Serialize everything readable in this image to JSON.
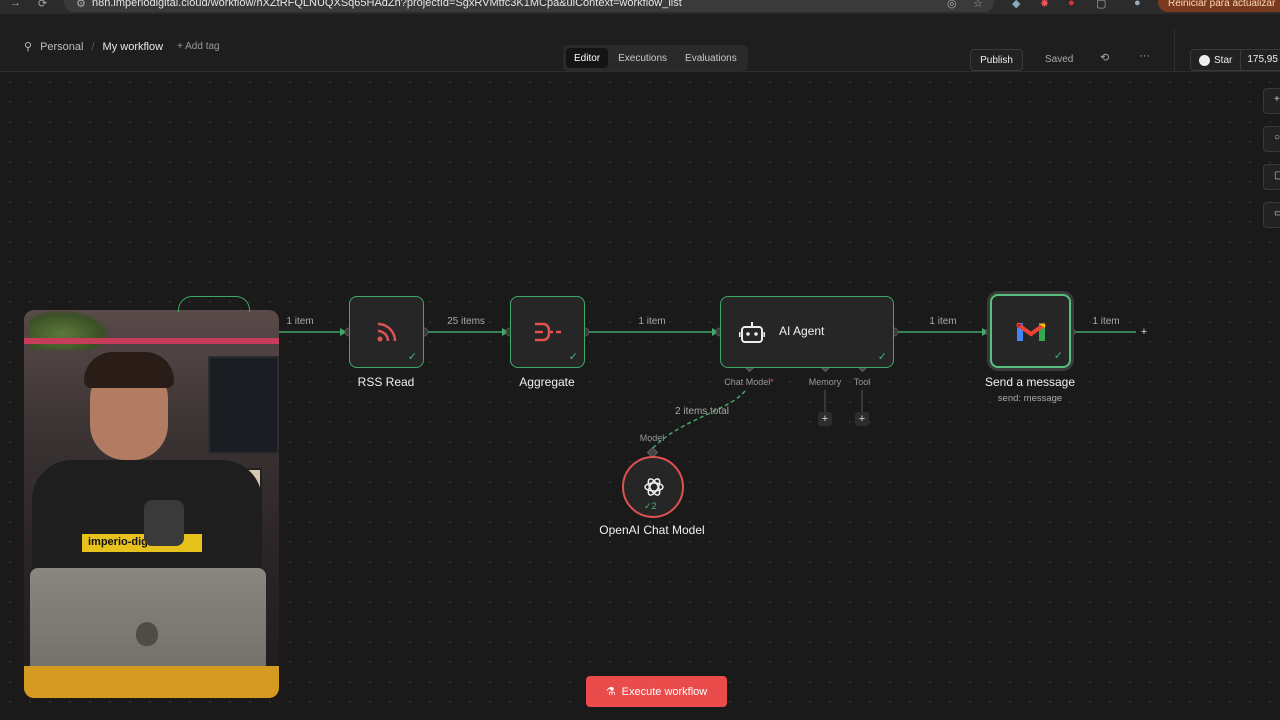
{
  "browser": {
    "url": "n8n.imperiodigital.cloud/workflow/hXZtRFQLNUQXSq65HAdZh?projectId=SgxRVMtfc3K1MCpa&uiContext=workflow_list",
    "update_label": "Reiniciar para actualizar"
  },
  "header": {
    "project": "Personal",
    "workflow_name": "My workflow",
    "add_tag": "+ Add tag",
    "tabs": [
      {
        "label": "Editor",
        "active": true
      },
      {
        "label": "Executions",
        "active": false
      },
      {
        "label": "Evaluations",
        "active": false
      }
    ],
    "publish_label": "Publish",
    "saved_label": "Saved",
    "star_label": "Star",
    "star_count": "175,95"
  },
  "nodes": {
    "rss": {
      "label": "RSS Read",
      "icon": "rss-icon"
    },
    "aggregate": {
      "label": "Aggregate",
      "icon": "aggregate-icon"
    },
    "ai_agent": {
      "label": "AI Agent",
      "icon": "robot-icon",
      "ports": {
        "chat_model": "Chat Model",
        "required_mark": "*",
        "memory": "Memory",
        "tool": "Tool"
      }
    },
    "gmail": {
      "label": "Send a message",
      "subtitle": "send: message",
      "icon": "gmail-icon"
    },
    "openai": {
      "label": "OpenAI Chat Model",
      "port_label": "Model",
      "run_count": "2",
      "icon": "openai-icon"
    }
  },
  "edges": {
    "into_rss": "1 item",
    "rss_to_aggregate": "25 items",
    "aggregate_to_agent": "1 item",
    "agent_to_gmail": "1 item",
    "gmail_out": "1 item",
    "model_link": "2 items total"
  },
  "footer": {
    "execute_label": "Execute workflow"
  },
  "colors": {
    "success": "#3fa86a",
    "danger": "#ea4b4b",
    "canvas": "#1a1a1a",
    "node": "#262626"
  }
}
